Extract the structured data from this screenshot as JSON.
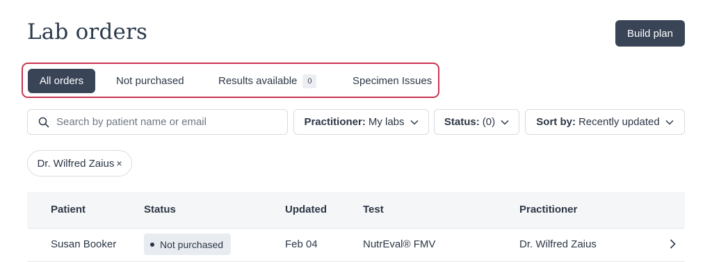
{
  "page": {
    "title": "Lab orders",
    "build_plan_label": "Build plan"
  },
  "tabs": [
    {
      "label": "All orders",
      "active": true
    },
    {
      "label": "Not purchased",
      "active": false
    },
    {
      "label": "Results available",
      "active": false,
      "count": "0"
    },
    {
      "label": "Specimen Issues",
      "active": false
    }
  ],
  "filters": {
    "search_placeholder": "Search by patient name or email",
    "practitioner": {
      "label": "Practitioner:",
      "value": "My labs"
    },
    "status": {
      "label": "Status:",
      "value": "(0)"
    },
    "sort": {
      "label": "Sort by:",
      "value": "Recently updated"
    }
  },
  "active_filter_chip": {
    "label": "Dr. Wilfred Zaius",
    "remove_glyph": "×"
  },
  "table": {
    "columns": [
      "Patient",
      "Status",
      "Updated",
      "Test",
      "Practitioner"
    ],
    "rows": [
      {
        "patient": "Susan Booker",
        "status": "Not purchased",
        "updated": "Feb 04",
        "test": "NutrEval® FMV",
        "practitioner": "Dr. Wilfred Zaius"
      }
    ]
  },
  "icons": {
    "search": "search-icon",
    "dropdown": "chevron-down-icon",
    "row_open": "chevron-right-icon"
  },
  "colors": {
    "primary_button": "#394457",
    "tabs_highlight_border": "#c9354f",
    "table_header_bg": "#f5f6f8",
    "status_badge_bg": "#e8ecf1"
  }
}
